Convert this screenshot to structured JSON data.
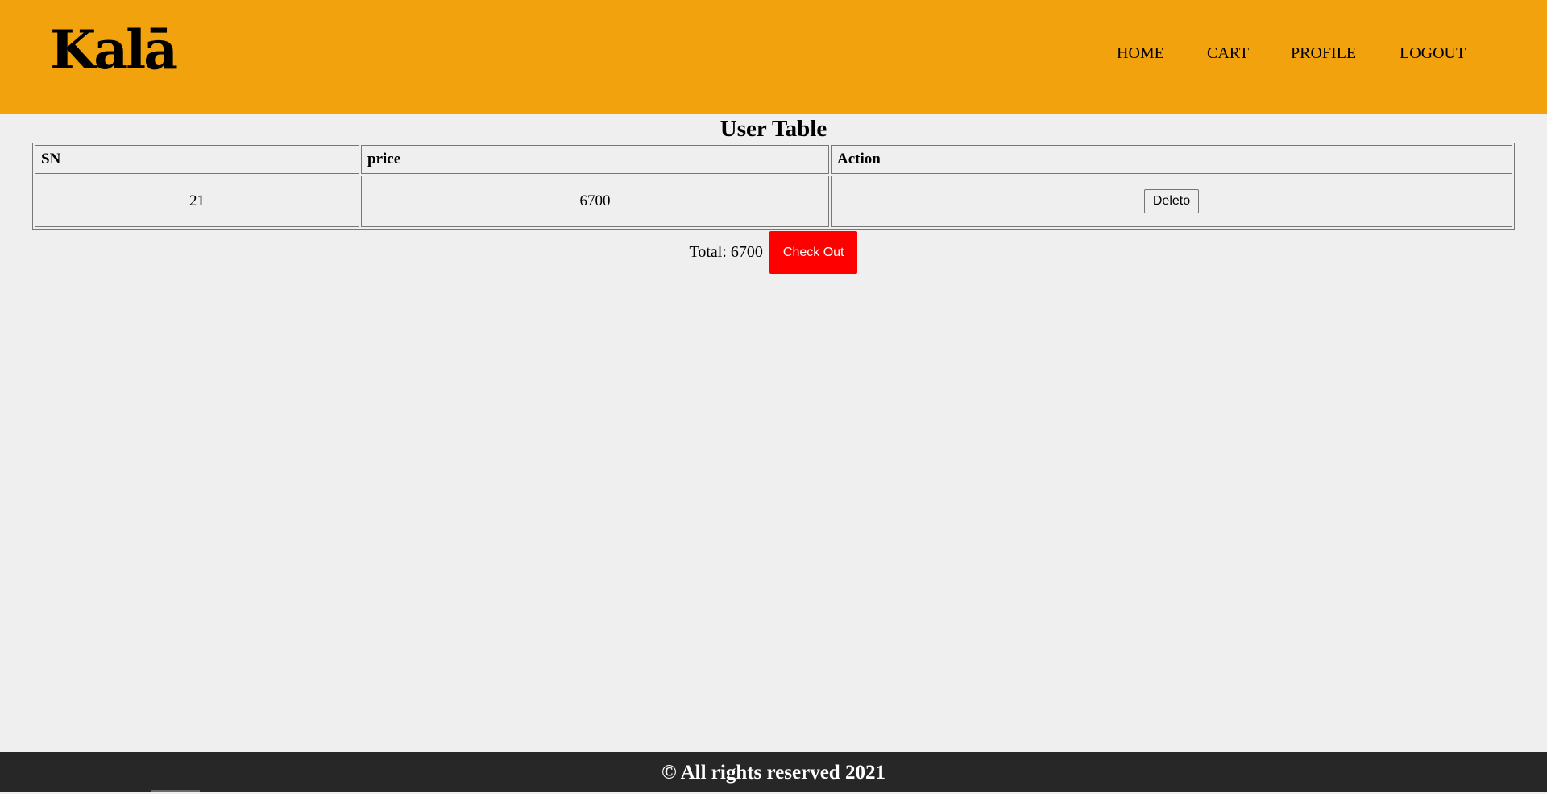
{
  "header": {
    "logo": "Kalā",
    "nav": [
      "HOME",
      "CART",
      "PROFILE",
      "LOGOUT"
    ]
  },
  "page": {
    "title": "User Table"
  },
  "table": {
    "headers": [
      "SN",
      "price",
      "Action"
    ],
    "rows": [
      {
        "sn": "21",
        "price": "6700",
        "action_label": "Deleto"
      }
    ]
  },
  "summary": {
    "total": "Total: 6700",
    "checkout_label": "Check Out"
  },
  "footer": {
    "text": "© All rights reserved 2021"
  },
  "colors": {
    "header_bg": "#f2a20d",
    "page_bg": "#efefef",
    "checkout_bg": "#ff0000",
    "footer_bg": "#272727"
  }
}
